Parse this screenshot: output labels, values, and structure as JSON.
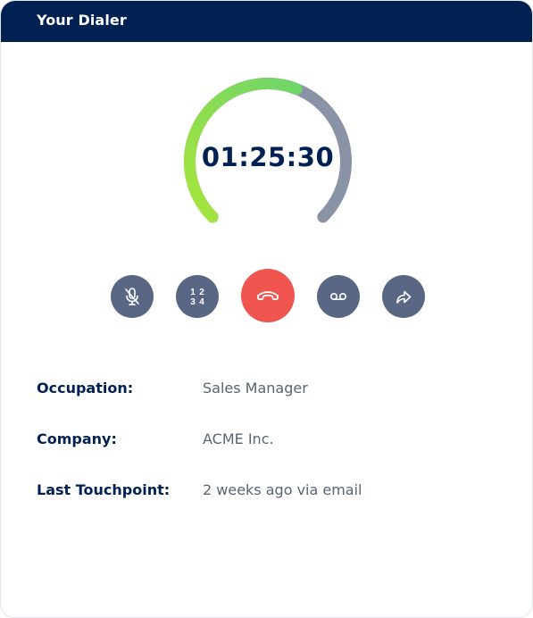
{
  "header": {
    "title": "Your Dialer"
  },
  "timer": {
    "display": "01:25:30",
    "progress_fraction": 0.58,
    "colors": {
      "track": "#8a93a6",
      "gradient_start": "#a6e53c",
      "gradient_end": "#6fd46a"
    }
  },
  "controls": [
    {
      "name": "mute-button",
      "icon": "mic-off-icon"
    },
    {
      "name": "keypad-button",
      "icon": "keypad-icon",
      "digits": [
        "1",
        "2",
        "3",
        "4"
      ]
    },
    {
      "name": "end-call-button",
      "icon": "phone-hangup-icon"
    },
    {
      "name": "voicemail-button",
      "icon": "voicemail-icon"
    },
    {
      "name": "transfer-button",
      "icon": "forward-icon"
    }
  ],
  "contact": {
    "rows": [
      {
        "label": "Occupation:",
        "value": "Sales Manager"
      },
      {
        "label": "Company:",
        "value": "ACME Inc."
      },
      {
        "label": "Last Touchpoint:",
        "value": "2 weeks ago via email"
      }
    ]
  },
  "colors": {
    "header_bg": "#002152",
    "control_bg": "#5a6784",
    "end_call_bg": "#f0554f",
    "text_dark": "#002152",
    "text_muted": "#5a6374"
  }
}
